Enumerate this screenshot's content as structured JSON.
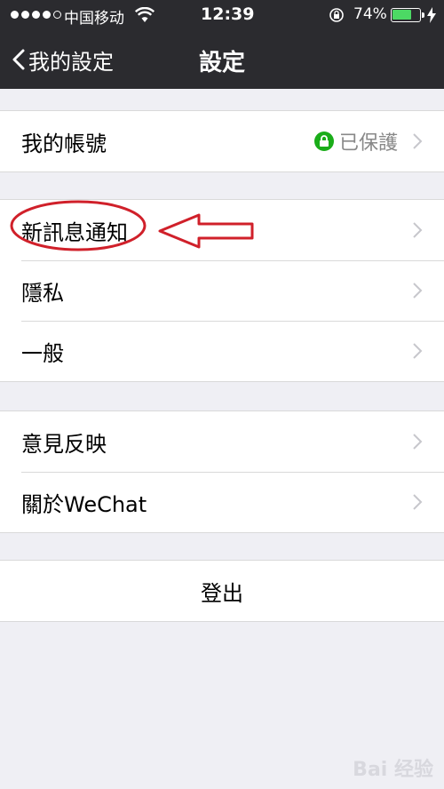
{
  "status_bar": {
    "carrier": "中国移动",
    "time": "12:39",
    "battery_percent": "74%",
    "battery_level": 0.74
  },
  "nav": {
    "back_label": "我的設定",
    "title": "設定"
  },
  "account": {
    "label": "我的帳號",
    "status": "已保護"
  },
  "group2": [
    {
      "label": "新訊息通知"
    },
    {
      "label": "隱私"
    },
    {
      "label": "一般"
    }
  ],
  "group3": [
    {
      "label": "意見反映"
    },
    {
      "label": "關於WeChat"
    }
  ],
  "logout": {
    "label": "登出"
  },
  "watermark": {
    "text": "Bai 经验"
  },
  "colors": {
    "nav_bg": "#2b2b2f",
    "page_bg": "#efeff4",
    "lock_green": "#1aad19",
    "annotation_red": "#d0202a"
  }
}
